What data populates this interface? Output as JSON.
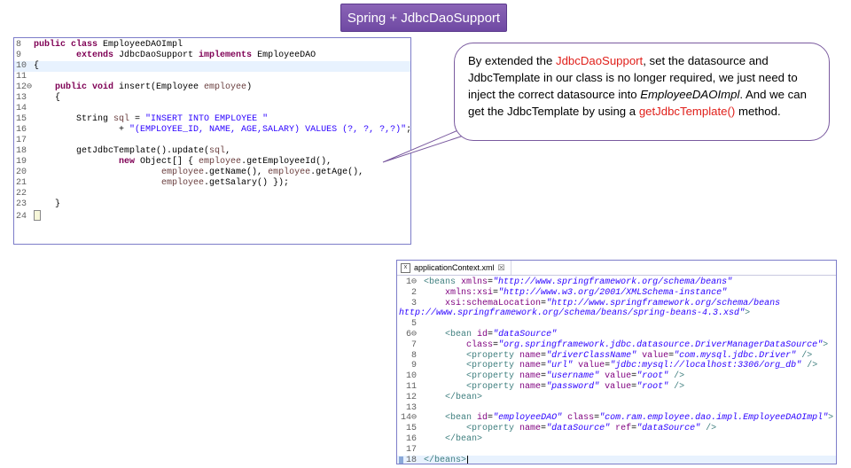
{
  "title": "Spring + JdbcDaoSupport",
  "java_editor": {
    "lines": [
      {
        "n": "8",
        "parts": [
          [
            "kw",
            "public class "
          ],
          [
            "",
            "EmployeeDAOImpl"
          ]
        ]
      },
      {
        "n": "9",
        "parts": [
          [
            "",
            "        "
          ],
          [
            "kw",
            "extends "
          ],
          [
            "",
            "JdbcDaoSupport "
          ],
          [
            "kw",
            "implements "
          ],
          [
            "",
            "EmployeeDAO"
          ]
        ]
      },
      {
        "n": "10",
        "cur": true,
        "parts": [
          [
            "",
            "{"
          ]
        ]
      },
      {
        "n": "11",
        "parts": []
      },
      {
        "n": "12⊖",
        "parts": [
          [
            "",
            "    "
          ],
          [
            "kw",
            "public void "
          ],
          [
            "",
            "insert(Employee "
          ],
          [
            "param",
            "employee"
          ],
          [
            "",
            ")"
          ]
        ]
      },
      {
        "n": "13",
        "parts": [
          [
            "",
            "    {"
          ]
        ]
      },
      {
        "n": "14",
        "parts": []
      },
      {
        "n": "15",
        "parts": [
          [
            "",
            "        String "
          ],
          [
            "param",
            "sql"
          ],
          [
            "",
            " = "
          ],
          [
            "str",
            "\"INSERT INTO EMPLOYEE \""
          ]
        ]
      },
      {
        "n": "16",
        "parts": [
          [
            "",
            "                + "
          ],
          [
            "str",
            "\"(EMPLOYEE_ID, NAME, AGE,SALARY) VALUES (?, ?, ?,?)\""
          ],
          [
            "",
            ";"
          ]
        ]
      },
      {
        "n": "17",
        "parts": []
      },
      {
        "n": "18",
        "parts": [
          [
            "",
            "        getJdbcTemplate().update("
          ],
          [
            "param",
            "sql"
          ],
          [
            "",
            ","
          ]
        ]
      },
      {
        "n": "19",
        "parts": [
          [
            "",
            "                "
          ],
          [
            "kw",
            "new "
          ],
          [
            "",
            "Object[] { "
          ],
          [
            "param",
            "employee"
          ],
          [
            "",
            ".getEmployeeId(),"
          ]
        ]
      },
      {
        "n": "20",
        "parts": [
          [
            "",
            "                        "
          ],
          [
            "param",
            "employee"
          ],
          [
            "",
            ".getName(), "
          ],
          [
            "param",
            "employee"
          ],
          [
            "",
            ".getAge(),"
          ]
        ]
      },
      {
        "n": "21",
        "parts": [
          [
            "",
            "                        "
          ],
          [
            "param",
            "employee"
          ],
          [
            "",
            ".getSalary() });"
          ]
        ]
      },
      {
        "n": "22",
        "parts": []
      },
      {
        "n": "23",
        "parts": [
          [
            "",
            "    }"
          ]
        ]
      },
      {
        "n": "24",
        "cursor": true,
        "parts": []
      }
    ]
  },
  "callout": {
    "t1": "By extended the ",
    "r1": "JdbcDaoSupport",
    "t2": ", set the datasource and JdbcTemplate in our class is no longer required, we just need to inject the correct datasource into ",
    "i1": "EmployeeDAOImpl",
    "t3": ". And we can get the JdbcTemplate by using a ",
    "r2": "getJdbcTemplate()",
    "t4": " method."
  },
  "xml_editor": {
    "tab_label": "applicationContext.xml",
    "tab_close": "☒",
    "tab_icon": "x",
    "lines": [
      {
        "n": "1⊖",
        "parts": [
          [
            "xtag",
            "<beans "
          ],
          [
            "xattr",
            "xmlns"
          ],
          [
            "",
            "="
          ],
          [
            "xval",
            "\"http://www.springframework.org/schema/beans\""
          ]
        ]
      },
      {
        "n": "2",
        "parts": [
          [
            "",
            "    "
          ],
          [
            "xattr",
            "xmlns:xsi"
          ],
          [
            "",
            "="
          ],
          [
            "xval",
            "\"http://www.w3.org/2001/XMLSchema-instance\""
          ]
        ]
      },
      {
        "n": "3",
        "parts": [
          [
            "",
            "    "
          ],
          [
            "xattr",
            "xsi:schemaLocation"
          ],
          [
            "",
            "="
          ],
          [
            "xval",
            "\"http://www.springframework.org/schema/beans"
          ]
        ]
      },
      {
        "n": "4",
        "nonum": true,
        "parts": [
          [
            "xval",
            "http://www.springframework.org/schema/beans/spring-beans-4.3.xsd\""
          ],
          [
            "xtag",
            ">"
          ]
        ]
      },
      {
        "n": "5",
        "parts": []
      },
      {
        "n": "6⊖",
        "parts": [
          [
            "",
            "    "
          ],
          [
            "xtag",
            "<bean "
          ],
          [
            "xattr",
            "id"
          ],
          [
            "",
            "="
          ],
          [
            "xval",
            "\"dataSource\""
          ]
        ]
      },
      {
        "n": "7",
        "parts": [
          [
            "",
            "        "
          ],
          [
            "xattr",
            "class"
          ],
          [
            "",
            "="
          ],
          [
            "xval",
            "\"org.springframework.jdbc.datasource.DriverManagerDataSource\""
          ],
          [
            "xtag",
            ">"
          ]
        ]
      },
      {
        "n": "8",
        "parts": [
          [
            "",
            "        "
          ],
          [
            "xtag",
            "<property "
          ],
          [
            "xattr",
            "name"
          ],
          [
            "",
            "="
          ],
          [
            "xval",
            "\"driverClassName\""
          ],
          [
            "",
            " "
          ],
          [
            "xattr",
            "value"
          ],
          [
            "",
            "="
          ],
          [
            "xval",
            "\"com.mysql.jdbc.Driver\""
          ],
          [
            "",
            " "
          ],
          [
            "xtag",
            "/>"
          ]
        ]
      },
      {
        "n": "9",
        "parts": [
          [
            "",
            "        "
          ],
          [
            "xtag",
            "<property "
          ],
          [
            "xattr",
            "name"
          ],
          [
            "",
            "="
          ],
          [
            "xval",
            "\"url\""
          ],
          [
            "",
            " "
          ],
          [
            "xattr",
            "value"
          ],
          [
            "",
            "="
          ],
          [
            "xval",
            "\"jdbc:mysql://localhost:3306/org_db\""
          ],
          [
            "",
            " "
          ],
          [
            "xtag",
            "/>"
          ]
        ]
      },
      {
        "n": "10",
        "parts": [
          [
            "",
            "        "
          ],
          [
            "xtag",
            "<property "
          ],
          [
            "xattr",
            "name"
          ],
          [
            "",
            "="
          ],
          [
            "xval",
            "\"username\""
          ],
          [
            "",
            " "
          ],
          [
            "xattr",
            "value"
          ],
          [
            "",
            "="
          ],
          [
            "xval",
            "\"root\""
          ],
          [
            "",
            " "
          ],
          [
            "xtag",
            "/>"
          ]
        ]
      },
      {
        "n": "11",
        "parts": [
          [
            "",
            "        "
          ],
          [
            "xtag",
            "<property "
          ],
          [
            "xattr",
            "name"
          ],
          [
            "",
            "="
          ],
          [
            "xval",
            "\"password\""
          ],
          [
            "",
            " "
          ],
          [
            "xattr",
            "value"
          ],
          [
            "",
            "="
          ],
          [
            "xval",
            "\"root\""
          ],
          [
            "",
            " "
          ],
          [
            "xtag",
            "/>"
          ]
        ]
      },
      {
        "n": "12",
        "parts": [
          [
            "",
            "    "
          ],
          [
            "xtag",
            "</bean>"
          ]
        ]
      },
      {
        "n": "13",
        "parts": []
      },
      {
        "n": "14⊖",
        "parts": [
          [
            "",
            "    "
          ],
          [
            "xtag",
            "<bean "
          ],
          [
            "xattr",
            "id"
          ],
          [
            "",
            "="
          ],
          [
            "xval",
            "\"employeeDAO\""
          ],
          [
            "",
            " "
          ],
          [
            "xattr",
            "class"
          ],
          [
            "",
            "="
          ],
          [
            "xval",
            "\"com.ram.employee.dao.impl.EmployeeDAOImpl\""
          ],
          [
            "xtag",
            ">"
          ]
        ]
      },
      {
        "n": "15",
        "parts": [
          [
            "",
            "        "
          ],
          [
            "xtag",
            "<property "
          ],
          [
            "xattr",
            "name"
          ],
          [
            "",
            "="
          ],
          [
            "xval",
            "\"dataSource\""
          ],
          [
            "",
            " "
          ],
          [
            "xattr",
            "ref"
          ],
          [
            "",
            "="
          ],
          [
            "xval",
            "\"dataSource\""
          ],
          [
            "",
            " "
          ],
          [
            "xtag",
            "/>"
          ]
        ]
      },
      {
        "n": "16",
        "parts": [
          [
            "",
            "    "
          ],
          [
            "xtag",
            "</bean>"
          ]
        ]
      },
      {
        "n": "17",
        "parts": []
      },
      {
        "n": "18",
        "cur": true,
        "parts": [
          [
            "xtag",
            "</beans>"
          ]
        ]
      }
    ]
  },
  "colors": {
    "title_bg": "#7a55ad",
    "callout_border": "#7a5a9f",
    "highlight_red": "#e0201b",
    "java_keyword": "#7f0055",
    "java_string": "#2a00ff",
    "xml_tag": "#3f7f7f",
    "xml_attr": "#7f007f"
  }
}
